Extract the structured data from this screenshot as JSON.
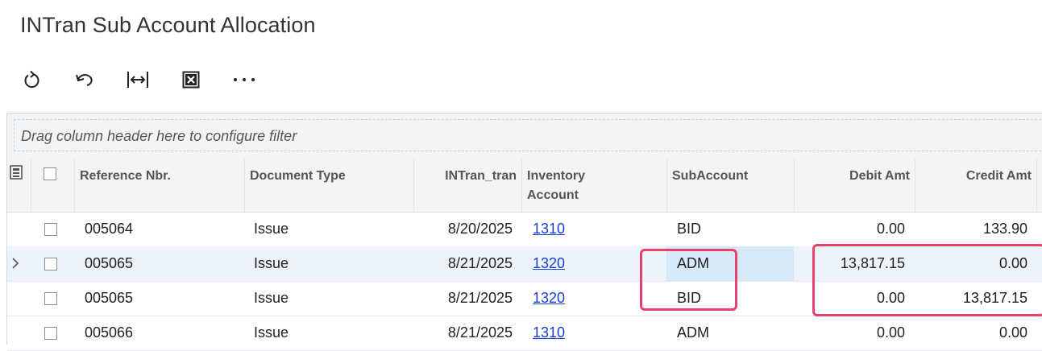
{
  "page": {
    "title": "INTran Sub Account Allocation"
  },
  "toolbar": {
    "buttons": [
      {
        "name": "refresh-icon"
      },
      {
        "name": "undo-icon"
      },
      {
        "name": "fit-columns-icon"
      },
      {
        "name": "export-excel-icon"
      },
      {
        "name": "more-icon"
      }
    ]
  },
  "grid": {
    "filter_placeholder": "Drag column header here to configure filter",
    "columns": {
      "reference_nbr": "Reference Nbr.",
      "document_type": "Document Type",
      "intran_tran": "INTran_tran",
      "inventory_account": "Inventory Account",
      "subaccount": "SubAccount",
      "debit_amt": "Debit Amt",
      "credit_amt": "Credit Amt"
    },
    "rows": [
      {
        "ref": "005064",
        "doc_type": "Issue",
        "date": "8/20/2025",
        "inv_account": "1310",
        "sub": "BID",
        "debit": "0.00",
        "credit": "133.90"
      },
      {
        "ref": "005065",
        "doc_type": "Issue",
        "date": "8/21/2025",
        "inv_account": "1320",
        "sub": "ADM",
        "debit": "13,817.15",
        "credit": "0.00"
      },
      {
        "ref": "005065",
        "doc_type": "Issue",
        "date": "8/21/2025",
        "inv_account": "1320",
        "sub": "BID",
        "debit": "0.00",
        "credit": "13,817.15"
      },
      {
        "ref": "005066",
        "doc_type": "Issue",
        "date": "8/21/2025",
        "inv_account": "1310",
        "sub": "ADM",
        "debit": "0.00",
        "credit": "0.00"
      }
    ]
  },
  "colors": {
    "highlight": "#e8416b",
    "link": "#1a3fd6",
    "active_row": "#edf3fa",
    "selected_cell": "#d7e8f6"
  }
}
